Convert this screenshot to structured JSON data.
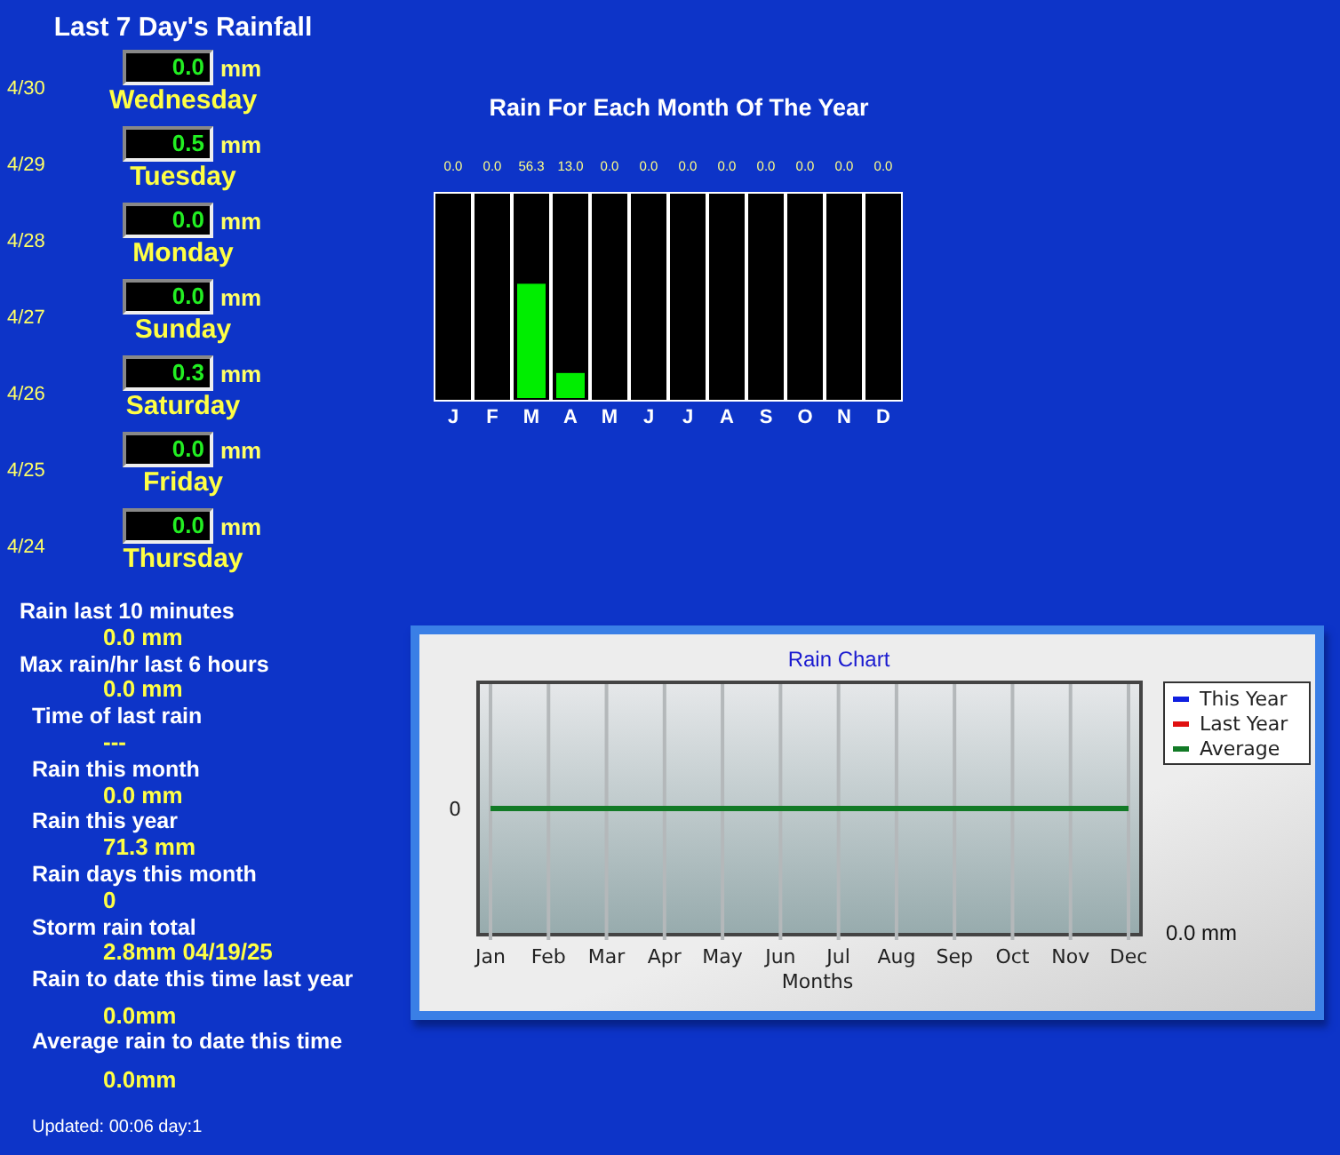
{
  "title": "Last 7 Day's Rainfall",
  "days": [
    {
      "date": "4/30",
      "amount": "0.0",
      "unit": "mm",
      "day": "Wednesday"
    },
    {
      "date": "4/29",
      "amount": "0.5",
      "unit": "mm",
      "day": "Tuesday"
    },
    {
      "date": "4/28",
      "amount": "0.0",
      "unit": "mm",
      "day": "Monday"
    },
    {
      "date": "4/27",
      "amount": "0.0",
      "unit": "mm",
      "day": "Sunday"
    },
    {
      "date": "4/26",
      "amount": "0.3",
      "unit": "mm",
      "day": "Saturday"
    },
    {
      "date": "4/25",
      "amount": "0.0",
      "unit": "mm",
      "day": "Friday"
    },
    {
      "date": "4/24",
      "amount": "0.0",
      "unit": "mm",
      "day": "Thursday"
    }
  ],
  "stats": [
    {
      "label": "Rain last 10 minutes",
      "value": "0.0 mm"
    },
    {
      "label": "Max rain/hr last 6 hours",
      "value": "0.0 mm"
    },
    {
      "label": "Time of last rain",
      "value": "---"
    },
    {
      "label": "Rain this month",
      "value": "0.0 mm"
    },
    {
      "label": "Rain this year",
      "value": "71.3 mm"
    },
    {
      "label": "Rain days this month",
      "value": "0"
    },
    {
      "label": "Storm rain total",
      "value": "2.8mm 04/19/25"
    },
    {
      "label": "Rain to date this time last year",
      "value": "0.0mm"
    },
    {
      "label": "Average rain to date this time",
      "value": "0.0mm"
    }
  ],
  "updated": "Updated: 00:06 day:1",
  "monthly": {
    "title": "Rain For Each Month Of The Year",
    "chart_data": {
      "type": "bar",
      "categories": [
        "J",
        "F",
        "M",
        "A",
        "M",
        "J",
        "J",
        "A",
        "S",
        "O",
        "N",
        "D"
      ],
      "values": [
        0.0,
        0.0,
        56.3,
        13.0,
        0.0,
        0.0,
        0.0,
        0.0,
        0.0,
        0.0,
        0.0,
        0.0
      ],
      "value_labels": [
        "0.0",
        "0.0",
        "56.3",
        "13.0",
        "0.0",
        "0.0",
        "0.0",
        "0.0",
        "0.0",
        "0.0",
        "0.0",
        "0.0"
      ],
      "ylim": [
        0,
        100
      ]
    }
  },
  "rain_chart": {
    "title": "Rain Chart",
    "axis_title": "Months",
    "months": [
      "Jan",
      "Feb",
      "Mar",
      "Apr",
      "May",
      "Jun",
      "Jul",
      "Aug",
      "Sep",
      "Oct",
      "Nov",
      "Dec"
    ],
    "tick_label": "0",
    "legend": [
      {
        "name": "This Year",
        "color": "#1020e0"
      },
      {
        "name": "Last Year",
        "color": "#e01010"
      },
      {
        "name": "Average",
        "color": "#127a26"
      }
    ],
    "reading": "0.0 mm"
  }
}
